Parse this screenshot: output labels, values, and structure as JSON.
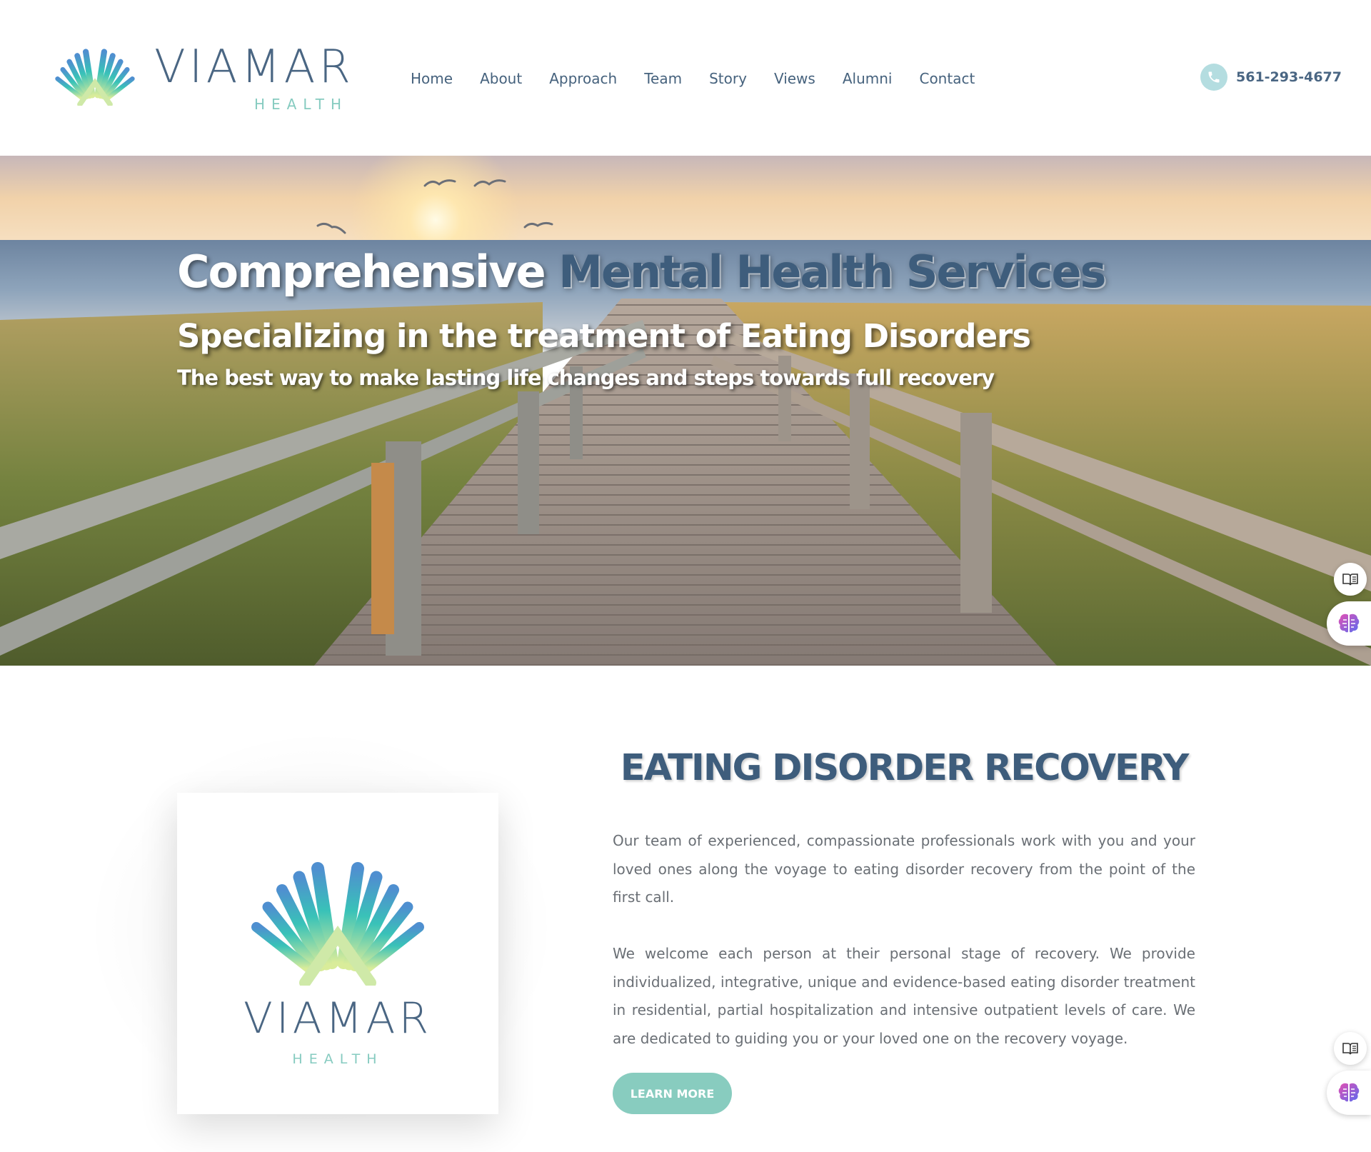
{
  "brand": {
    "name": "VIAMAR",
    "subtitle": "HEALTH"
  },
  "nav": {
    "items": [
      "Home",
      "About",
      "Approach",
      "Team",
      "Story",
      "Views",
      "Alumni",
      "Contact"
    ]
  },
  "contact": {
    "phone": "561-293-4677",
    "icon": "phone-icon"
  },
  "hero": {
    "title_white": "Comprehensive",
    "title_blue": "Mental Health Services",
    "subtitle": "Specializing in the treatment of Eating Disorders",
    "tagline": "The best way to make lasting life changes and steps towards full recovery"
  },
  "widgets": [
    "book-icon",
    "brain-icon"
  ],
  "section": {
    "title": "EATING DISORDER RECOVERY",
    "paragraph1": "Our team of experienced, compassionate professionals work with you and your loved ones along the voyage to eating disorder recovery from the point of the first call.",
    "paragraph2": "We welcome each person at their personal stage of recovery. We provide individualized, integrative, unique and evidence-based eating disorder treatment in residential, partial hospitalization and intensive outpatient levels of care. We are dedicated to guiding you or your loved one on the recovery voyage.",
    "button": "LEARN MORE"
  },
  "colors": {
    "brand_blue": "#3e5d7c",
    "brand_teal": "#86cbc0",
    "button_green": "#88ccbf",
    "body_text": "#6a6f75"
  }
}
